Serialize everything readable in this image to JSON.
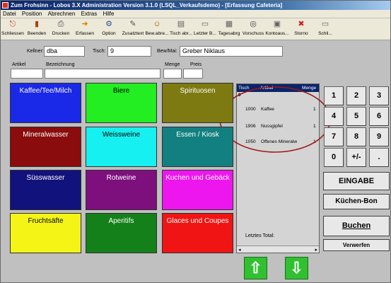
{
  "window": {
    "title": "Zum Frohsinn - Lobos 3.X Administration Version 3.1.0 (LSQL_Verkaufsdemo) - [Erfassung Cafeteria]"
  },
  "menu": [
    {
      "label": "Datei"
    },
    {
      "label": "Position"
    },
    {
      "label": "Abrechnen"
    },
    {
      "label": "Extras"
    },
    {
      "label": "Hilfe"
    }
  ],
  "toolbar": [
    {
      "label": "Schliessen",
      "icon": "door-exit-icon",
      "glyph": "⎋",
      "color": "#c03020"
    },
    {
      "label": "Beenden",
      "icon": "stop-icon",
      "glyph": "▮",
      "color": "#b04010"
    },
    {
      "label": "Drucken",
      "icon": "printer-icon",
      "glyph": "⎙",
      "color": "#404040"
    },
    {
      "label": "Erfassen",
      "icon": "arrow-icon",
      "glyph": "➜",
      "color": "#d08000"
    },
    {
      "label": "Option",
      "icon": "options-icon",
      "glyph": "⚙",
      "color": "#3050a0"
    },
    {
      "label": "Zusatztext",
      "icon": "note-icon",
      "glyph": "✎",
      "color": "#505050"
    },
    {
      "label": "Bew.abre...",
      "icon": "guest-icon",
      "glyph": "☺",
      "color": "#a06000"
    },
    {
      "label": "Tisch abr...",
      "icon": "table-icon",
      "glyph": "▤",
      "color": "#606060"
    },
    {
      "label": "Letzter B...",
      "icon": "receipt-icon",
      "glyph": "▭",
      "color": "#606060"
    },
    {
      "label": "Tagesabrg",
      "icon": "calendar-icon",
      "glyph": "▦",
      "color": "#606060"
    },
    {
      "label": "Vorschuss",
      "icon": "binoculars-icon",
      "glyph": "◎",
      "color": "#404040"
    },
    {
      "label": "Kontoaus...",
      "icon": "account-icon",
      "glyph": "▣",
      "color": "#606060"
    },
    {
      "label": "Storno",
      "icon": "cancel-icon",
      "glyph": "✖",
      "color": "#d02020"
    },
    {
      "label": "Schli...",
      "icon": "close-icon",
      "glyph": "▭",
      "color": "#606060"
    }
  ],
  "form": {
    "kellner_label": "Kellner:",
    "kellner_value": "dba",
    "tisch_label": "Tisch:",
    "tisch_value": "9",
    "bew_label": "Bew/Mai:",
    "bew_value": "Greber Niklaus",
    "artikel_label": "Artikel",
    "bezeichnung_label": "Bezeichnung",
    "menge_label": "Menge",
    "preis_label": "Preis",
    "artikel_value": "",
    "bezeichnung_value": "",
    "menge_value": "",
    "preis_value": ""
  },
  "categories": [
    {
      "label": "Kaffee/Tee/Milch",
      "bg": "#1a28e8",
      "fg": "#ffffff"
    },
    {
      "label": "Biere",
      "bg": "#22ee22",
      "fg": "#000000"
    },
    {
      "label": "Spirituosen",
      "bg": "#7e7a12",
      "fg": "#ffffff"
    },
    {
      "label": "Mineralwasser",
      "bg": "#8a0c0c",
      "fg": "#ffffff"
    },
    {
      "label": "Weissweine",
      "bg": "#16f0f0",
      "fg": "#000000"
    },
    {
      "label": "Essen / Kiosk",
      "bg": "#128080",
      "fg": "#ffffff"
    },
    {
      "label": "Süsswasser",
      "bg": "#12127c",
      "fg": "#ffffff"
    },
    {
      "label": "Rotweine",
      "bg": "#7e107e",
      "fg": "#ffffff"
    },
    {
      "label": "Kuchen und Gebäck",
      "bg": "#ee16ee",
      "fg": "#ffffff"
    },
    {
      "label": "Fruchtsäfte",
      "bg": "#f4f416",
      "fg": "#000000"
    },
    {
      "label": "Aperitifs",
      "bg": "#14801a",
      "fg": "#ffffff"
    },
    {
      "label": "Glaces und Coupes",
      "bg": "#f01414",
      "fg": "#ffffff"
    }
  ],
  "order": {
    "headers": [
      "Tisch",
      "Artikel",
      "Menge"
    ],
    "table_number": "9",
    "rows": [
      {
        "code": "1000",
        "name": "Kaffee",
        "qty": "1"
      },
      {
        "code": "1906",
        "name": "Nussgipfel",
        "qty": "1"
      },
      {
        "code": "1050",
        "name": "Offenes Mineralw",
        "qty": "1"
      }
    ],
    "total_label": "Letztes Total:"
  },
  "keypad": [
    "1",
    "2",
    "3",
    "4",
    "5",
    "6",
    "7",
    "8",
    "9",
    "0",
    "+/-",
    "."
  ],
  "buttons": {
    "eingabe": "EINGABE",
    "kuechen_bon": "Küchen-Bon",
    "buchen": "Buchen",
    "verwerfen": "Verwerfen"
  },
  "arrows": {
    "up": "up-arrow-icon",
    "down": "down-arrow-icon"
  },
  "colors": {
    "highlight": "#a01818",
    "titlebar": "#0a246a"
  }
}
